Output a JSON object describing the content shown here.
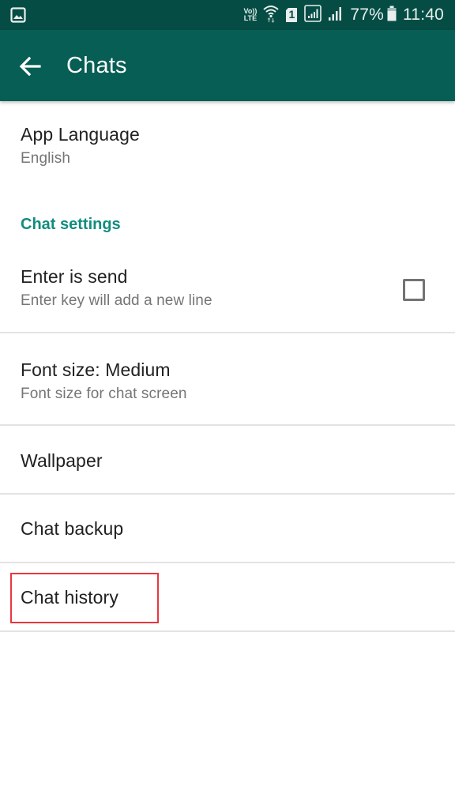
{
  "status_bar": {
    "left_icon": "gallery-notification-icon",
    "volte_top": "Vo))",
    "volte_bottom": "LTE",
    "icons": [
      "volte-icon",
      "wifi-icon",
      "sim-1-icon",
      "signal-sim1-icon",
      "signal-sim2-icon",
      "battery-icon"
    ],
    "sim_label": "1",
    "battery_percent": "77%",
    "battery_level": 0.77,
    "time": "11:40"
  },
  "app_bar": {
    "back_icon": "arrow-back-icon",
    "title": "Chats"
  },
  "colors": {
    "status_bar": "#054d44",
    "app_bar": "#075e54",
    "accent": "#128c7e",
    "highlight": "#e8373d"
  },
  "preferences": {
    "app_language": {
      "title": "App Language",
      "summary": "English"
    },
    "section_chat_settings": "Chat settings",
    "enter_is_send": {
      "title": "Enter is send",
      "summary": "Enter key will add a new line",
      "checked": false
    },
    "font_size": {
      "title": "Font size: Medium",
      "summary": "Font size for chat screen"
    },
    "wallpaper": {
      "title": "Wallpaper"
    },
    "chat_backup": {
      "title": "Chat backup"
    },
    "chat_history": {
      "title": "Chat history",
      "highlighted": true
    }
  }
}
